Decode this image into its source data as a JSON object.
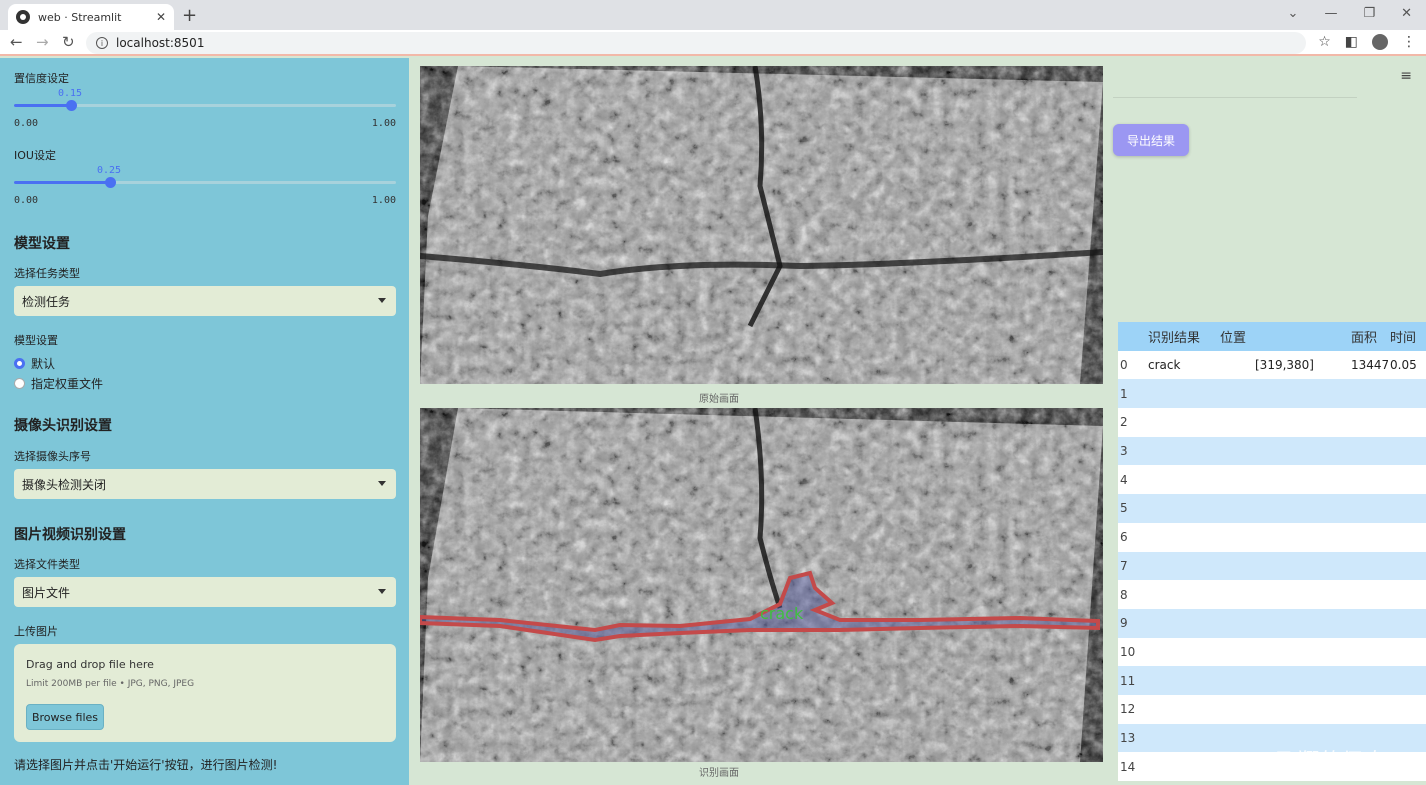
{
  "browser": {
    "tab_title": "web · Streamlit",
    "url": "localhost:8501"
  },
  "sidebar": {
    "confidence": {
      "label": "置信度设定",
      "value": "0.15",
      "min": "0.00",
      "max": "1.00",
      "fraction": 0.15
    },
    "iou": {
      "label": "IOU设定",
      "value": "0.25",
      "min": "0.00",
      "max": "1.00",
      "fraction": 0.25
    },
    "model_section": {
      "heading": "模型设置",
      "task_label": "选择任务类型",
      "task_value": "检测任务",
      "model_label": "模型设置",
      "radio_options": [
        "默认",
        "指定权重文件"
      ],
      "radio_selected": 0
    },
    "camera_section": {
      "heading": "摄像头识别设置",
      "camera_label": "选择摄像头序号",
      "camera_value": "摄像头检测关闭"
    },
    "media_section": {
      "heading": "图片视频识别设置",
      "file_type_label": "选择文件类型",
      "file_type_value": "图片文件",
      "upload_label": "上传图片",
      "drop_text": "Drag and drop file here",
      "limit_text": "Limit 200MB per file • JPG, PNG, JPEG",
      "browse_label": "Browse files"
    },
    "hint": "请选择图片并点击'开始运行'按钮，进行图片检测!"
  },
  "main": {
    "original_caption": "原始画面",
    "result_caption": "识别画面",
    "detection_label": "crack"
  },
  "right": {
    "export_label": "导出结果",
    "table": {
      "headers": [
        "",
        "识别结果",
        "位置",
        "面积",
        "时间"
      ],
      "rows": [
        [
          "0",
          "crack",
          "[319,380]",
          "13447",
          "0.05"
        ],
        [
          "1",
          "",
          "",
          "",
          ""
        ],
        [
          "2",
          "",
          "",
          "",
          ""
        ],
        [
          "3",
          "",
          "",
          "",
          ""
        ],
        [
          "4",
          "",
          "",
          "",
          ""
        ],
        [
          "5",
          "",
          "",
          "",
          ""
        ],
        [
          "6",
          "",
          "",
          "",
          ""
        ],
        [
          "7",
          "",
          "",
          "",
          ""
        ],
        [
          "8",
          "",
          "",
          "",
          ""
        ],
        [
          "9",
          "",
          "",
          "",
          ""
        ],
        [
          "10",
          "",
          "",
          "",
          ""
        ],
        [
          "11",
          "",
          "",
          "",
          ""
        ],
        [
          "12",
          "",
          "",
          "",
          ""
        ],
        [
          "13",
          "",
          "",
          "",
          ""
        ],
        [
          "14",
          "",
          "",
          "",
          ""
        ]
      ]
    },
    "watermark": "CSDN @飞翔的佩奇"
  },
  "colors": {
    "sidebar_bg": "#7ec6d8",
    "accent": "#4a70f2",
    "export_button": "#9b97f2",
    "table_header": "#9dd3f7",
    "detection_outline": "#c44a4a"
  }
}
